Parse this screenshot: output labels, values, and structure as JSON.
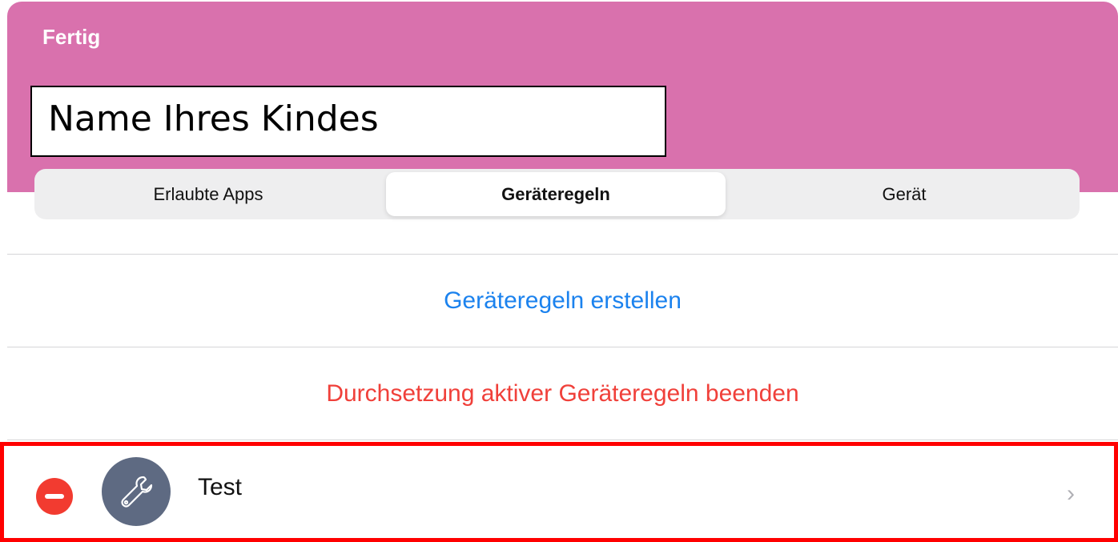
{
  "header": {
    "done_label": "Fertig",
    "child_name": "Name Ihres Kindes"
  },
  "tabs": [
    {
      "label": "Erlaubte Apps",
      "selected": false
    },
    {
      "label": "Geräteregeln",
      "selected": true
    },
    {
      "label": "Gerät",
      "selected": false
    }
  ],
  "actions": {
    "create_label": "Geräteregeln erstellen",
    "stop_label": "Durchsetzung aktiver Geräteregeln beenden"
  },
  "rules": [
    {
      "name": "Test",
      "icon": "wrench-icon"
    }
  ],
  "colors": {
    "header_bg": "#d971ad",
    "link_blue": "#1b82ee",
    "destructive_red": "#f0403a",
    "highlight_border": "#ff0000"
  }
}
